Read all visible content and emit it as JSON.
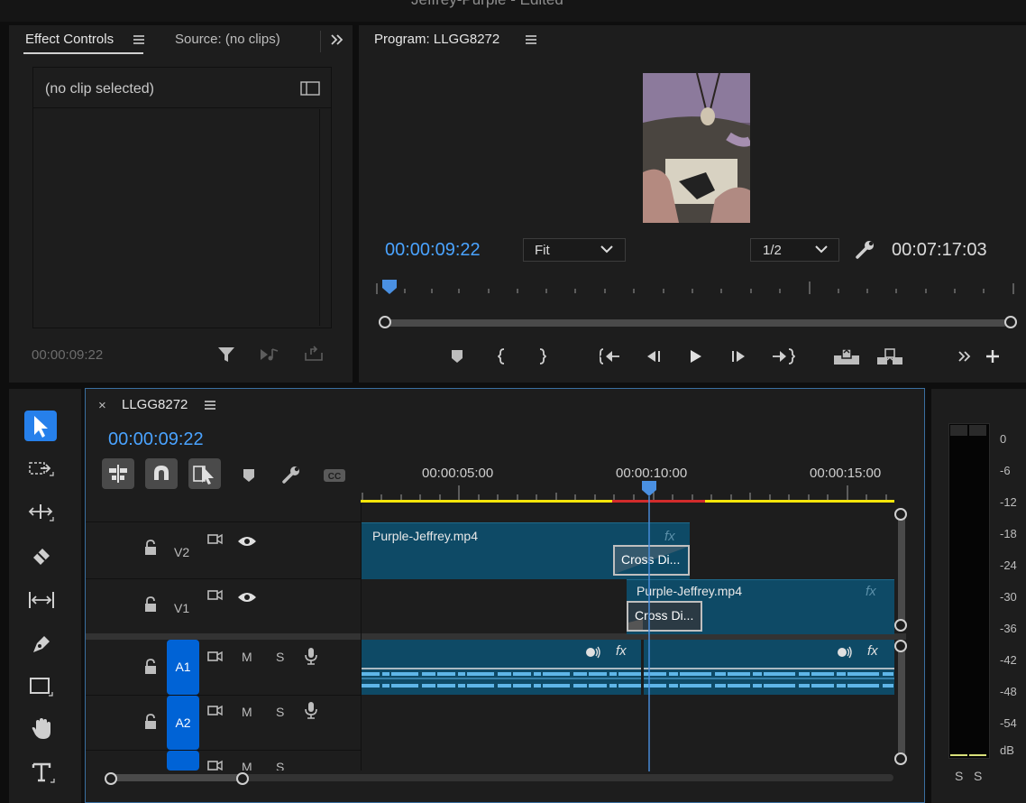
{
  "app": {
    "title": "Jeffrey-Purple - Edited"
  },
  "left_panel": {
    "tabs": [
      {
        "label": "Effect Controls",
        "active": true
      },
      {
        "label": "Source: (no clips)",
        "active": false
      }
    ],
    "no_clip_text": "(no clip selected)",
    "timecode": "00:00:09:22"
  },
  "program": {
    "title": "Program: LLGG8272",
    "timecode": "00:00:09:22",
    "fit": "Fit",
    "resolution": "1/2",
    "duration": "00:07:17:03"
  },
  "timeline": {
    "sequence": "LLGG8272",
    "close": "×",
    "timecode": "00:00:09:22",
    "ruler_labels": [
      "00:00:05:00",
      "00:00:10:00",
      "00:00:15:00"
    ],
    "tracks": {
      "v2": "V2",
      "v1": "V1",
      "a1": "A1",
      "a2": "A2",
      "m": "M",
      "s": "S"
    },
    "clips": {
      "v2_clip": "Purple-Jeffrey.mp4",
      "v1_clip": "Purple-Jeffrey.mp4",
      "transition_v2": "Cross Di...",
      "transition_v1": "Cross Di...",
      "fx": "fx"
    }
  },
  "meter": {
    "scale": [
      "0",
      "-6",
      "-12",
      "-18",
      "-24",
      "-30",
      "-36",
      "-42",
      "-48",
      "-54",
      "dB"
    ],
    "solo": [
      "S",
      "S"
    ]
  },
  "colors": {
    "accent": "#4aa3ff",
    "clip": "#0e4a66",
    "track_label_blue": "#0063d6",
    "work_area": "#f5e50a",
    "render_red": "#d22b2b"
  }
}
